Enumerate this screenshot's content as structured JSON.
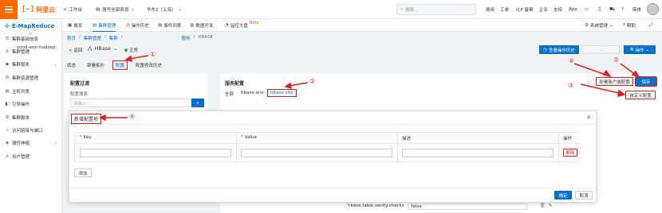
{
  "topbar": {
    "logo": "阿里云",
    "workbench": "工作台",
    "account": "账号全部资源",
    "region": "华东2（上海）",
    "search_placeholder": "搜索...",
    "nav": [
      "费用",
      "工单",
      "ICP 备案",
      "企业",
      "支持",
      "App"
    ],
    "lang": "简体"
  },
  "sidebar": {
    "brand": "E-MapReduce",
    "collapse": "≡",
    "cluster": "-prod-emr-hadoop",
    "items": [
      {
        "label": "集群基础信息",
        "icon": "☰",
        "chev": ""
      },
      {
        "label": "集群管理",
        "icon": "♙",
        "chev": ""
      },
      {
        "label": "集群服务",
        "icon": "◉",
        "chev": "⌄"
      },
      {
        "label": "集群资源管理",
        "icon": "⚙",
        "chev": ""
      },
      {
        "label": "主机列表",
        "icon": "▤",
        "chev": ""
      },
      {
        "label": "引导操作",
        "icon": "◧",
        "chev": ""
      },
      {
        "label": "集群脚本",
        "icon": "⚙",
        "chev": ""
      },
      {
        "label": "访问链接与端口",
        "icon": "⌁",
        "chev": ""
      },
      {
        "label": "弹性伸缩",
        "icon": "◈",
        "chev": "⌄"
      },
      {
        "label": "用户管理",
        "icon": "♙",
        "chev": ""
      }
    ]
  },
  "svcbar": {
    "tabs": [
      {
        "label": "概览",
        "icon": "▦"
      },
      {
        "label": "集群管理",
        "icon": "▤"
      },
      {
        "label": "操作历史",
        "icon": "◷"
      },
      {
        "label": "事件列表",
        "icon": "▤"
      },
      {
        "label": "数据开发",
        "icon": "▥"
      },
      {
        "label": "监控大盘",
        "icon": "◔"
      }
    ],
    "beta": "Beta",
    "sys_manage": "系统管理",
    "help": "帮助"
  },
  "breadcrumb": [
    "首页",
    "集群管理",
    "集群",
    "服务",
    "HBASE"
  ],
  "service": {
    "back": "< 返回",
    "name": "HBase",
    "status": "正常",
    "view_history_button": "查看操作历史",
    "disabled_button": "",
    "action_button": "操作"
  },
  "subtabs": [
    "状态",
    "部署拓扑",
    "配置",
    "配置修改历史"
  ],
  "config_filter": {
    "title": "配置过滤",
    "search_label": "配置搜索",
    "search_placeholder": "请输入"
  },
  "service_config": {
    "title": "服务配置",
    "all_label": "全部",
    "tabs": [
      "hbase-env",
      "hbase-site"
    ],
    "deploy_client_button": "部署客户端配置",
    "save_button": "保存",
    "custom_config_button": "自定义配置"
  },
  "bottom_row": {
    "key": "hbase.table.sanity.checks",
    "value": "false"
  },
  "dialog": {
    "title": "新增配置项",
    "columns": {
      "key": "Key",
      "value": "Value",
      "desc": "描述",
      "op": "操作"
    },
    "delete_button": "删除",
    "add_button": "添加",
    "confirm_button": "确定",
    "cancel_button": "取消"
  },
  "annotations": [
    "①",
    "②",
    "③",
    "④",
    "⑤",
    "⑥"
  ],
  "colors": {
    "accent": "#0070cc",
    "brand": "#ff6a00",
    "annotation": "#e02020",
    "status_ok": "#1db954"
  }
}
